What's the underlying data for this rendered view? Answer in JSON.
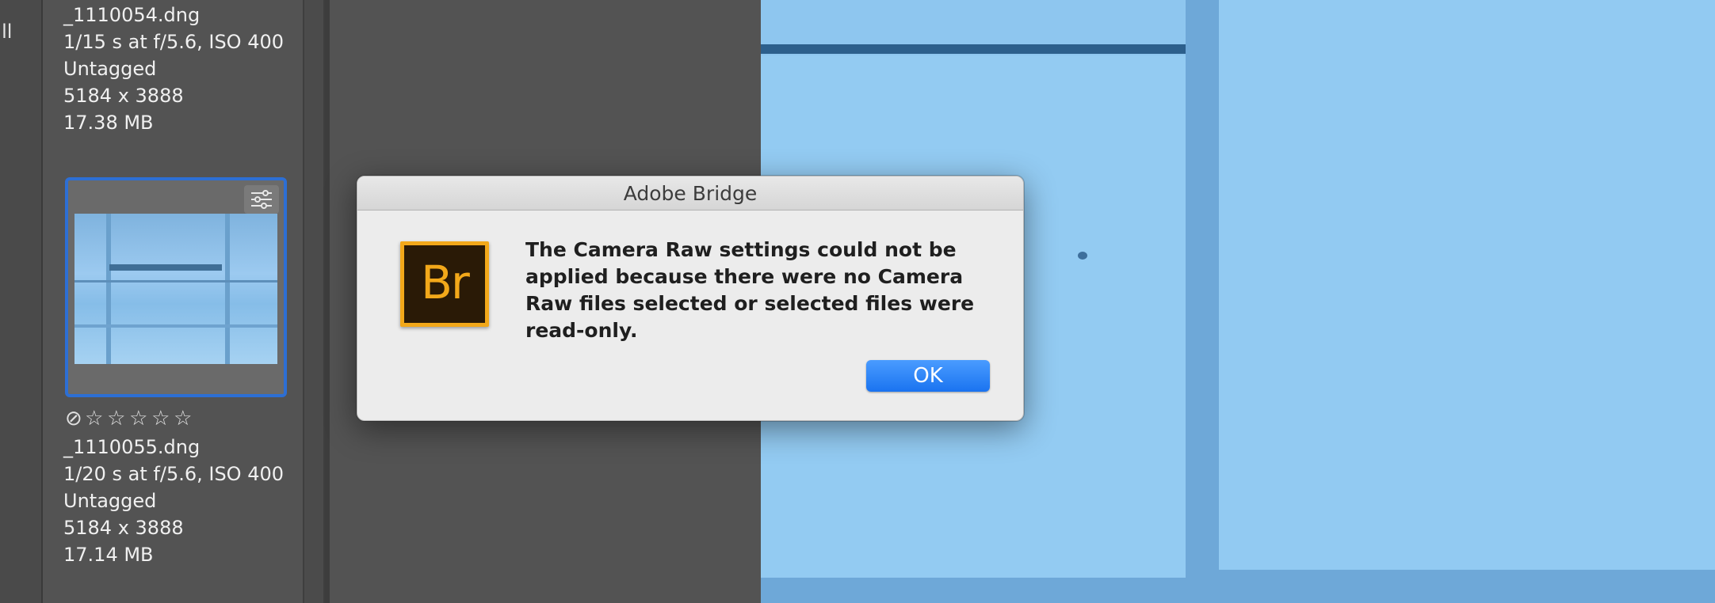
{
  "left_strip": {
    "label": "tall"
  },
  "files": [
    {
      "name": "_1110054.dng",
      "exposure": "1/15 s at f/5.6, ISO 400",
      "tag": "Untagged",
      "dimensions": "5184 x 3888",
      "size": "17.38 MB"
    },
    {
      "name": "_1110055.dng",
      "exposure": "1/20 s at f/5.6, ISO 400",
      "tag": "Untagged",
      "dimensions": "5184 x 3888",
      "size": "17.14 MB",
      "selected": true,
      "rating": {
        "stars": 0,
        "max": 5
      }
    }
  ],
  "icons": {
    "reject": "⊘",
    "star_empty": "☆",
    "settings": "sliders-icon"
  },
  "dialog": {
    "title": "Adobe Bridge",
    "app_icon_text": "Br",
    "message": "The Camera Raw settings could not be applied because there were no Camera Raw files selected or selected files were read-only.",
    "ok_label": "OK"
  },
  "colors": {
    "selection": "#2d6fd4",
    "ok_button": "#1a73f0",
    "bridge_orange": "#f2a81a",
    "preview_blue": "#8ec6ef"
  }
}
